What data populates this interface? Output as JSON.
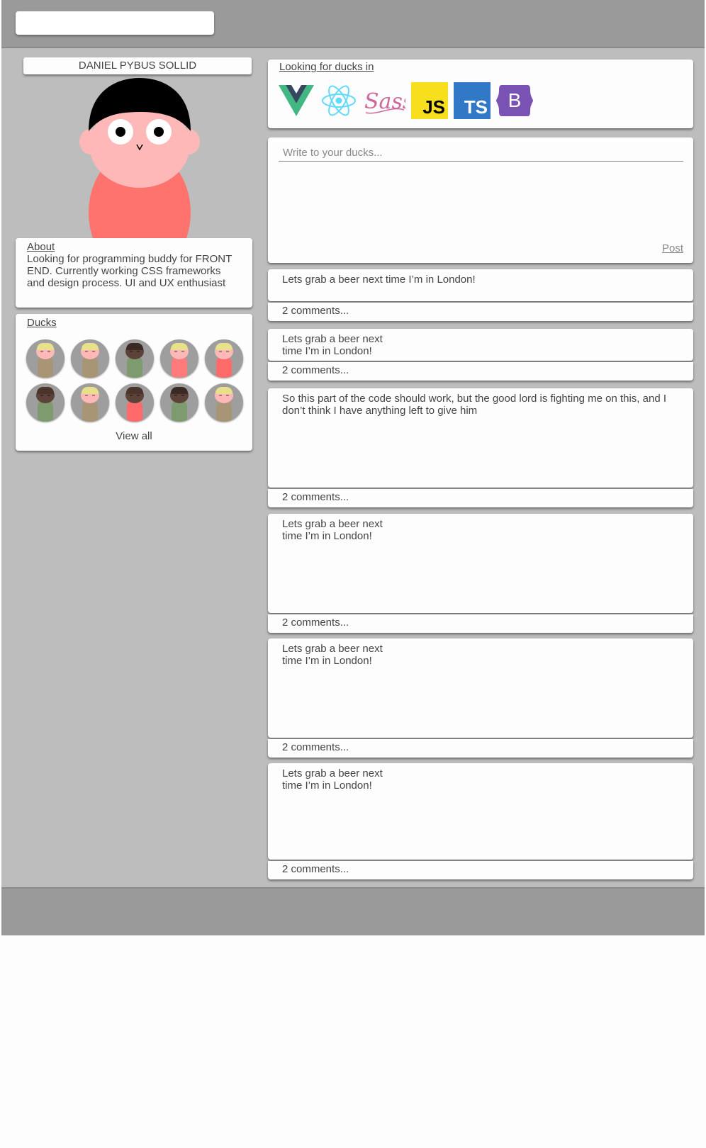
{
  "header": {
    "search_placeholder": ""
  },
  "profile": {
    "name": "DANIEL PYBUS SOLLID",
    "about_heading": "About",
    "about_text": "Looking for programming buddy for FRONT END. Currently working CSS frameworks and design process. UI and UX enthusiast",
    "colors": {
      "skin": "#ffb8b8",
      "hair": "#000000",
      "shirt": "#ff736e"
    }
  },
  "ducks": {
    "heading": "Ducks",
    "view_all": "View all",
    "items": [
      {
        "skin": "#ffb8b8",
        "hair": "#e8e08a",
        "body": "#a89576"
      },
      {
        "skin": "#ffb8b8",
        "hair": "#e8e08a",
        "body": "#a89576"
      },
      {
        "skin": "#5c4238",
        "hair": "#3b2a24",
        "body": "#7e9b6f"
      },
      {
        "skin": "#ffb8b8",
        "hair": "#e8e08a",
        "body": "#ff7b7b"
      },
      {
        "skin": "#ffb8b8",
        "hair": "#e8e08a",
        "body": "#ff6b6b"
      },
      {
        "skin": "#5c4238",
        "hair": "#4a342c",
        "body": "#7e9b6f"
      },
      {
        "skin": "#ffb8b8",
        "hair": "#e8e08a",
        "body": "#a89576"
      },
      {
        "skin": "#5c4238",
        "hair": "#4a342c",
        "body": "#ff6b6b"
      },
      {
        "skin": "#5c4238",
        "hair": "#3b2a24",
        "body": "#7e9b6f"
      },
      {
        "skin": "#ffb8b8",
        "hair": "#e8e08a",
        "body": "#a89576"
      }
    ]
  },
  "looking": {
    "heading": "Looking for ducks in",
    "logos": [
      {
        "name": "vue-logo",
        "color": "#41b883"
      },
      {
        "name": "react-logo",
        "color": "#61dafb"
      },
      {
        "name": "sass-logo",
        "color": "#cd6799"
      },
      {
        "name": "javascript-logo",
        "color": "#f7df1e",
        "label": "JS"
      },
      {
        "name": "typescript-logo",
        "color": "#3178c6",
        "label": "TS"
      },
      {
        "name": "bootstrap-logo",
        "color": "#7952b3",
        "label": "B"
      }
    ]
  },
  "composer": {
    "placeholder": "Write to your ducks...",
    "post_label": "Post"
  },
  "posts": [
    {
      "text": "Lets grab a beer next time I’m in London!",
      "comments": "2 comments..."
    },
    {
      "text": "Lets grab a beer next time I’m in London!",
      "comments": "2 comments..."
    },
    {
      "text": "So this part of the code should work, but the good lord is fighting me on this, and I don’t think I have anything left to give him",
      "comments": "2 comments..."
    },
    {
      "text": "Lets grab a beer next time I’m in London!",
      "comments": "2 comments..."
    },
    {
      "text": "Lets grab a beer next time I’m in London!",
      "comments": "2 comments..."
    },
    {
      "text": "Lets grab a beer next time I’m in London!",
      "comments": "2 comments..."
    }
  ]
}
